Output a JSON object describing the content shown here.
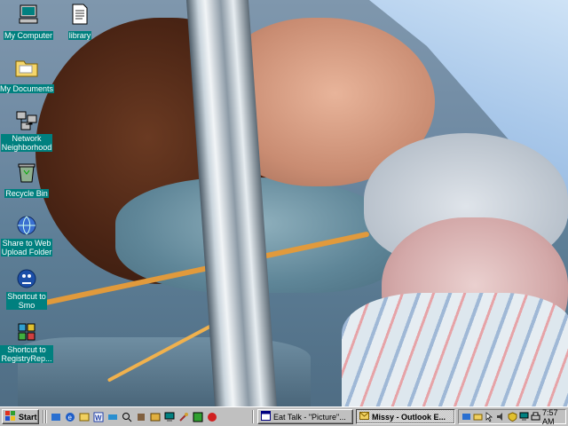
{
  "desktop": {
    "icons": [
      {
        "label": "My Computer",
        "icon": "my-computer-icon"
      },
      {
        "label": "library",
        "icon": "document-icon"
      },
      {
        "label": "My Documents",
        "icon": "folder-icon"
      },
      {
        "label": "Network\nNeighborhood",
        "icon": "network-icon"
      },
      {
        "label": "Recycle Bin",
        "icon": "recycle-bin-icon"
      },
      {
        "label": "Share to Web\nUpload Folder",
        "icon": "web-share-icon"
      },
      {
        "label": "Shortcut to\nSmo",
        "icon": "shortcut-icon"
      },
      {
        "label": "Shortcut to\nRegistryRep...",
        "icon": "registry-icon"
      }
    ]
  },
  "taskbar": {
    "start_label": "Start",
    "tasks": [
      {
        "label": "Eat Talk - \"Picture\"..."
      },
      {
        "label": "Missy - Outlook E..."
      }
    ],
    "clock": "7:57 AM"
  },
  "colors": {
    "taskbar": "#c0c0c0",
    "icon_label_bg": "#00807f",
    "highlight": "#000080"
  }
}
